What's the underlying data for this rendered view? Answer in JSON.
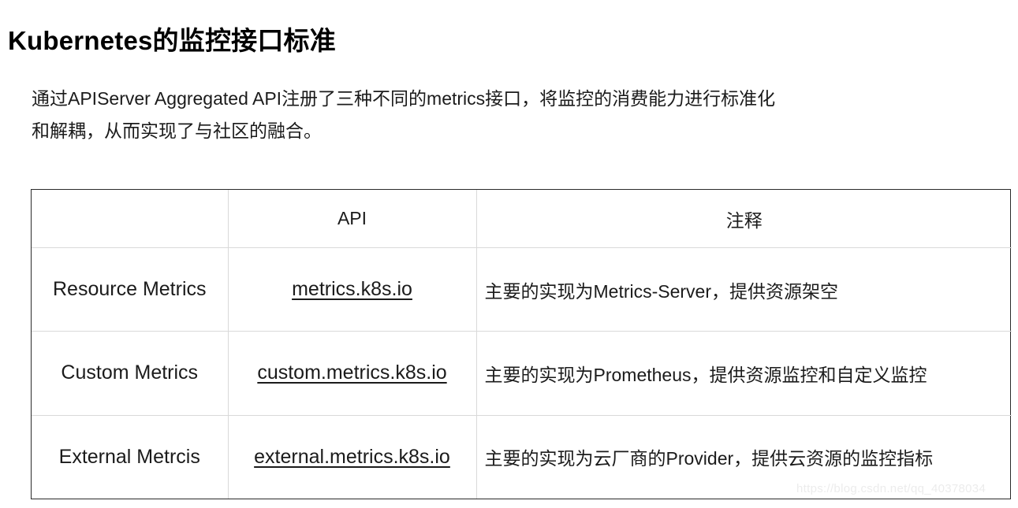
{
  "page": {
    "title": "Kubernetes的监控接口标准",
    "intro": {
      "line1": "通过APIServer Aggregated API注册了三种不同的metrics接口，将监控的消费能力进行标准化",
      "line2": "和解耦，从而实现了与社区的融合。"
    },
    "watermark": "https://blog.csdn.net/qq_40378034"
  },
  "table": {
    "headers": {
      "col0": "",
      "col1": "API",
      "col2": "注释"
    },
    "rows": [
      {
        "name": "Resource Metrics",
        "api": "metrics.k8s.io",
        "note": "主要的实现为Metrics-Server，提供资源架空"
      },
      {
        "name": "Custom Metrics",
        "api": "custom.metrics.k8s.io",
        "note": "主要的实现为Prometheus，提供资源监控和自定义监控"
      },
      {
        "name": "External Metrcis",
        "api": "external.metrics.k8s.io",
        "note": "主要的实现为云厂商的Provider，提供云资源的监控指标"
      }
    ]
  },
  "colors": {
    "background": "#ffffff",
    "text": "#1b1b1b",
    "title": "#000000",
    "table_outer_border": "#2a2a2a",
    "table_inner_border": "#d9d9d9",
    "watermark": "#ececec"
  }
}
